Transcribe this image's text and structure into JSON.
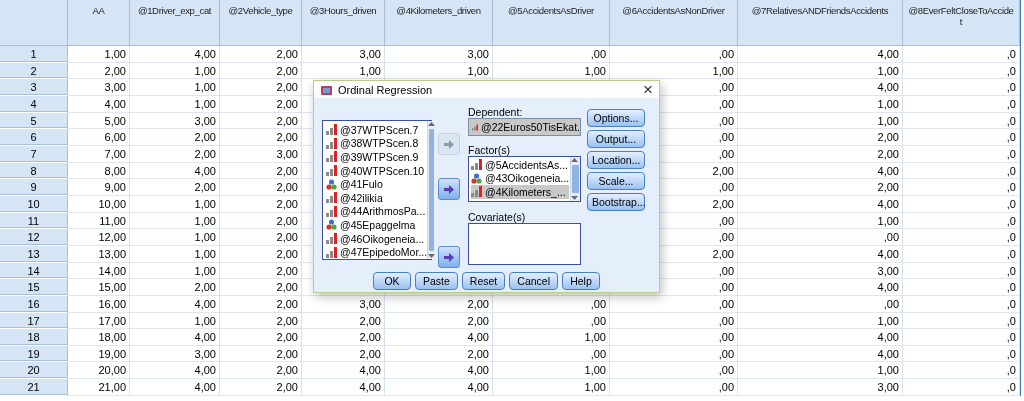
{
  "grid": {
    "columns": [
      "AA",
      "@1Driver_exp_cat",
      "@2Vehicle_type",
      "@3Hours_driven",
      "@4Kilometers_driven",
      "@5AccidentsAsDriver",
      "@6AccidentsAsNonDriver",
      "@7RelativesANDFriendsAccidents",
      "@8EverFeltCloseToAccide\nt"
    ],
    "rows": [
      {
        "number": "1",
        "cells": [
          "1,00",
          "4,00",
          "2,00",
          "3,00",
          "3,00",
          ",00",
          ",00",
          "4,00",
          ",0"
        ]
      },
      {
        "number": "2",
        "cells": [
          "2,00",
          "1,00",
          "2,00",
          "1,00",
          "1,00",
          "1,00",
          "1,00",
          "1,00",
          ",0"
        ]
      },
      {
        "number": "3",
        "cells": [
          "3,00",
          "1,00",
          "2,00",
          null,
          null,
          null,
          ",00",
          "4,00",
          ",0"
        ]
      },
      {
        "number": "4",
        "cells": [
          "4,00",
          "1,00",
          "2,00",
          null,
          null,
          null,
          ",00",
          "1,00",
          ",0"
        ]
      },
      {
        "number": "5",
        "cells": [
          "5,00",
          "3,00",
          "2,00",
          null,
          null,
          null,
          ",00",
          "1,00",
          ",0"
        ]
      },
      {
        "number": "6",
        "cells": [
          "6,00",
          "2,00",
          "2,00",
          null,
          null,
          null,
          ",00",
          "2,00",
          ",0"
        ]
      },
      {
        "number": "7",
        "cells": [
          "7,00",
          "2,00",
          "3,00",
          null,
          null,
          null,
          ",00",
          "2,00",
          ",0"
        ]
      },
      {
        "number": "8",
        "cells": [
          "8,00",
          "4,00",
          "2,00",
          null,
          null,
          null,
          "2,00",
          "4,00",
          ",0"
        ]
      },
      {
        "number": "9",
        "cells": [
          "9,00",
          "2,00",
          "2,00",
          null,
          null,
          null,
          ",00",
          "2,00",
          ",0"
        ]
      },
      {
        "number": "10",
        "cells": [
          "10,00",
          "1,00",
          "2,00",
          null,
          null,
          null,
          "2,00",
          "4,00",
          ",0"
        ]
      },
      {
        "number": "11",
        "cells": [
          "11,00",
          "1,00",
          "2,00",
          null,
          null,
          null,
          ",00",
          "1,00",
          ",0"
        ]
      },
      {
        "number": "12",
        "cells": [
          "12,00",
          "1,00",
          "2,00",
          null,
          null,
          null,
          ",00",
          ",00",
          ",0"
        ]
      },
      {
        "number": "13",
        "cells": [
          "13,00",
          "1,00",
          "2,00",
          null,
          null,
          null,
          "2,00",
          "4,00",
          ",0"
        ]
      },
      {
        "number": "14",
        "cells": [
          "14,00",
          "1,00",
          "2,00",
          null,
          null,
          null,
          ",00",
          "3,00",
          ",0"
        ]
      },
      {
        "number": "15",
        "cells": [
          "15,00",
          "2,00",
          "2,00",
          null,
          null,
          null,
          ",00",
          "4,00",
          ",0"
        ]
      },
      {
        "number": "16",
        "cells": [
          "16,00",
          "4,00",
          "2,00",
          "3,00",
          "2,00",
          ",00",
          ",00",
          ",00",
          ",0"
        ]
      },
      {
        "number": "17",
        "cells": [
          "17,00",
          "1,00",
          "2,00",
          "2,00",
          "2,00",
          ",00",
          ",00",
          "1,00",
          ",0"
        ]
      },
      {
        "number": "18",
        "cells": [
          "18,00",
          "4,00",
          "2,00",
          "2,00",
          "4,00",
          "1,00",
          ",00",
          "4,00",
          ",0"
        ]
      },
      {
        "number": "19",
        "cells": [
          "19,00",
          "3,00",
          "2,00",
          "2,00",
          "2,00",
          ",00",
          ",00",
          "4,00",
          ",0"
        ]
      },
      {
        "number": "20",
        "cells": [
          "20,00",
          "4,00",
          "2,00",
          "4,00",
          "4,00",
          "1,00",
          ",00",
          "1,00",
          ",0"
        ]
      },
      {
        "number": "21",
        "cells": [
          "21,00",
          "4,00",
          "2,00",
          "4,00",
          "4,00",
          "1,00",
          ",00",
          "3,00",
          ",0"
        ]
      }
    ]
  },
  "dialog": {
    "title": "Ordinal Regression",
    "close": "×",
    "variables": [
      {
        "name": "@37WTPScen.7",
        "kind": "scale"
      },
      {
        "name": "@38WTPScen.8",
        "kind": "scale"
      },
      {
        "name": "@39WTPScen.9",
        "kind": "scale"
      },
      {
        "name": "@40WTPScen.10",
        "kind": "scale"
      },
      {
        "name": "@41Fulo",
        "kind": "nominal"
      },
      {
        "name": "@42ilikia",
        "kind": "scale"
      },
      {
        "name": "@44ArithmosPa...",
        "kind": "scale"
      },
      {
        "name": "@45Epaggelma",
        "kind": "nominal"
      },
      {
        "name": "@46Oikogeneia...",
        "kind": "scale"
      },
      {
        "name": "@47EpipedoMor...",
        "kind": "scale"
      }
    ],
    "move_buttons": [
      {
        "disabled": true
      },
      {
        "disabled": false
      },
      {
        "disabled": false
      }
    ],
    "dependent": {
      "label": "Dependent:",
      "value": {
        "name": "@22Euros50TisEkat.",
        "kind": "scale"
      }
    },
    "factors": {
      "label": "Factor(s)",
      "items": [
        {
          "name": "@5AccidentsAs...",
          "kind": "scale",
          "selected": false
        },
        {
          "name": "@43Oikogeneia...",
          "kind": "nominal",
          "selected": false
        },
        {
          "name": "@4Kilometers_...",
          "kind": "scale",
          "selected": true
        }
      ]
    },
    "covariates": {
      "label": "Covariate(s)"
    },
    "side_buttons": [
      "Options...",
      "Output...",
      "Location...",
      "Scale...",
      "Bootstrap..."
    ],
    "bottom_buttons": [
      "OK",
      "Paste",
      "Reset",
      "Cancel",
      "Help"
    ]
  }
}
